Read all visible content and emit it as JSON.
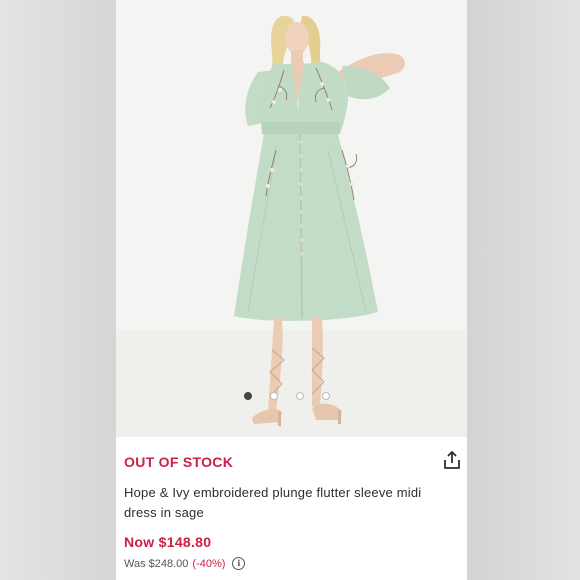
{
  "product": {
    "status": "OUT OF STOCK",
    "title": "Hope & Ivy embroidered plunge flutter sleeve midi dress in sage",
    "price_now": "Now $148.80",
    "price_was": "Was $248.00",
    "discount": "(-40%)",
    "info_icon": "i"
  },
  "gallery": {
    "image_count": 4,
    "active_index": 0,
    "image_subject": "model wearing sage green embroidered midi dress"
  },
  "icons": {
    "share": "share-icon",
    "info": "info-icon"
  },
  "colors": {
    "accent": "#cc1f48",
    "dress": "#bfd9c4",
    "text": "#2d2d2d"
  }
}
